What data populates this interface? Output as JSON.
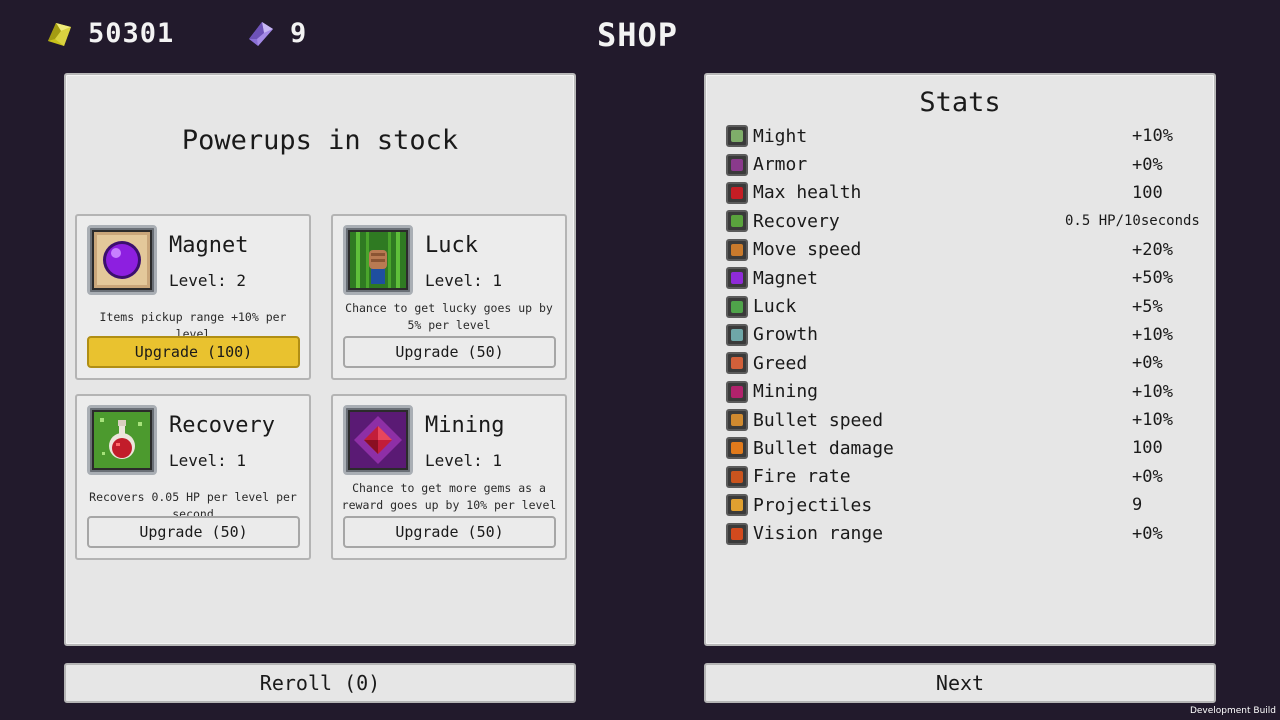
{
  "header": {
    "gold_amount": "50301",
    "gold_icon": "gold-crystal-icon",
    "gem_amount": "9",
    "gem_icon": "purple-gem-icon",
    "title": "SHOP"
  },
  "powerups": {
    "heading": "Powerups in stock",
    "cards": [
      {
        "name": "Magnet",
        "level": "Level: 2",
        "description": "Items pickup range +10% per level",
        "button": "Upgrade (100)",
        "icon": "magnet-orb-icon",
        "affordable": true
      },
      {
        "name": "Luck",
        "level": "Level: 1",
        "description": "Chance to get lucky goes up by 5% per level",
        "button": "Upgrade (50)",
        "icon": "luck-fist-icon",
        "affordable": false
      },
      {
        "name": "Recovery",
        "level": "Level: 1",
        "description": "Recovers 0.05 HP per level per second",
        "button": "Upgrade (50)",
        "icon": "recovery-potion-icon",
        "affordable": false
      },
      {
        "name": "Mining",
        "level": "Level: 1",
        "description": "Chance to get more gems as a reward goes up by 10% per level",
        "button": "Upgrade (50)",
        "icon": "mining-gem-icon",
        "affordable": false
      }
    ]
  },
  "stats": {
    "heading": "Stats",
    "rows": [
      {
        "label": "Might",
        "value": "+10%",
        "icon": "might-skull-icon",
        "color": "#7fae6a"
      },
      {
        "label": "Armor",
        "value": "+0%",
        "icon": "armor-icon",
        "color": "#8a3a8c"
      },
      {
        "label": "Max health",
        "value": "100",
        "icon": "heart-icon",
        "color": "#c41d24"
      },
      {
        "label": "Recovery",
        "value": "0.5 HP/10seconds",
        "icon": "recovery-icon",
        "color": "#5aa33d"
      },
      {
        "label": "Move speed",
        "value": "+20%",
        "icon": "boot-icon",
        "color": "#c97a2c"
      },
      {
        "label": "Magnet",
        "value": "+50%",
        "icon": "magnet-icon",
        "color": "#8f2bd8"
      },
      {
        "label": "Luck",
        "value": "+5%",
        "icon": "clover-icon",
        "color": "#4fa34a"
      },
      {
        "label": "Growth",
        "value": "+10%",
        "icon": "growth-icon",
        "color": "#6fa7a8"
      },
      {
        "label": "Greed",
        "value": "+0%",
        "icon": "greed-icon",
        "color": "#d1603a"
      },
      {
        "label": "Mining",
        "value": "+10%",
        "icon": "pickaxe-icon",
        "color": "#b1226c"
      },
      {
        "label": "Bullet speed",
        "value": "+10%",
        "icon": "bullet-speed-icon",
        "color": "#d08a2f"
      },
      {
        "label": "Bullet damage",
        "value": "100",
        "icon": "bullet-damage-icon",
        "color": "#e07a1c"
      },
      {
        "label": "Fire rate",
        "value": "+0%",
        "icon": "fire-rate-icon",
        "color": "#c9541e"
      },
      {
        "label": "Projectiles",
        "value": "9",
        "icon": "projectiles-icon",
        "color": "#e0a030"
      },
      {
        "label": "Vision range",
        "value": "+0%",
        "icon": "eye-icon",
        "color": "#d24a1e"
      }
    ]
  },
  "buttons": {
    "reroll": "Reroll (0)",
    "next": "Next"
  },
  "footer": {
    "build_label": "Development Build"
  }
}
